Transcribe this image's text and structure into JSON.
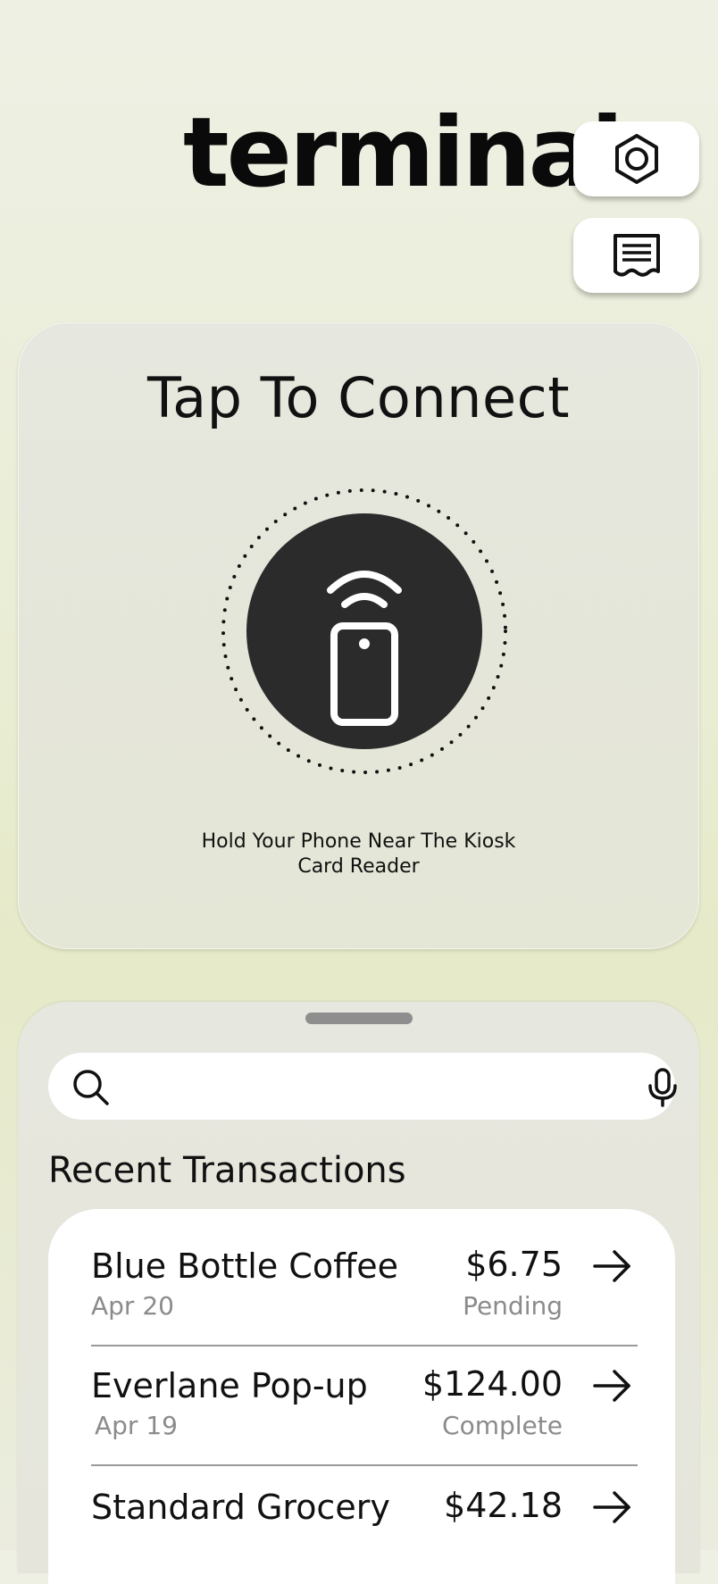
{
  "app": {
    "logo_text": "terminal"
  },
  "header": {
    "settings_icon": "hexagon-settings-icon",
    "receipt_icon": "receipt-icon"
  },
  "connect": {
    "title": "Tap To Connect",
    "icon": "nfc-phone-icon",
    "hint_line1": "Hold Your Phone Near The Kiosk",
    "hint_line2": "Card Reader"
  },
  "search": {
    "placeholder": "",
    "value": "",
    "search_icon": "search-icon",
    "mic_icon": "mic-icon"
  },
  "transactions": {
    "title": "Recent Transactions",
    "items": [
      {
        "name": "Blue Bottle Coffee",
        "date": "Apr 20",
        "amount": "$6.75",
        "status": "Pending"
      },
      {
        "name": "Everlane Pop-up",
        "date": "Apr 19",
        "amount": "$124.00",
        "status": "Complete"
      },
      {
        "name": "Standard Grocery",
        "date": "",
        "amount": "$42.18",
        "status": ""
      }
    ]
  },
  "colors": {
    "background": "#eef0e4",
    "card": "#e6e7de",
    "graphic_dark": "#2b2b2b",
    "muted_text": "#8b8b8b"
  }
}
